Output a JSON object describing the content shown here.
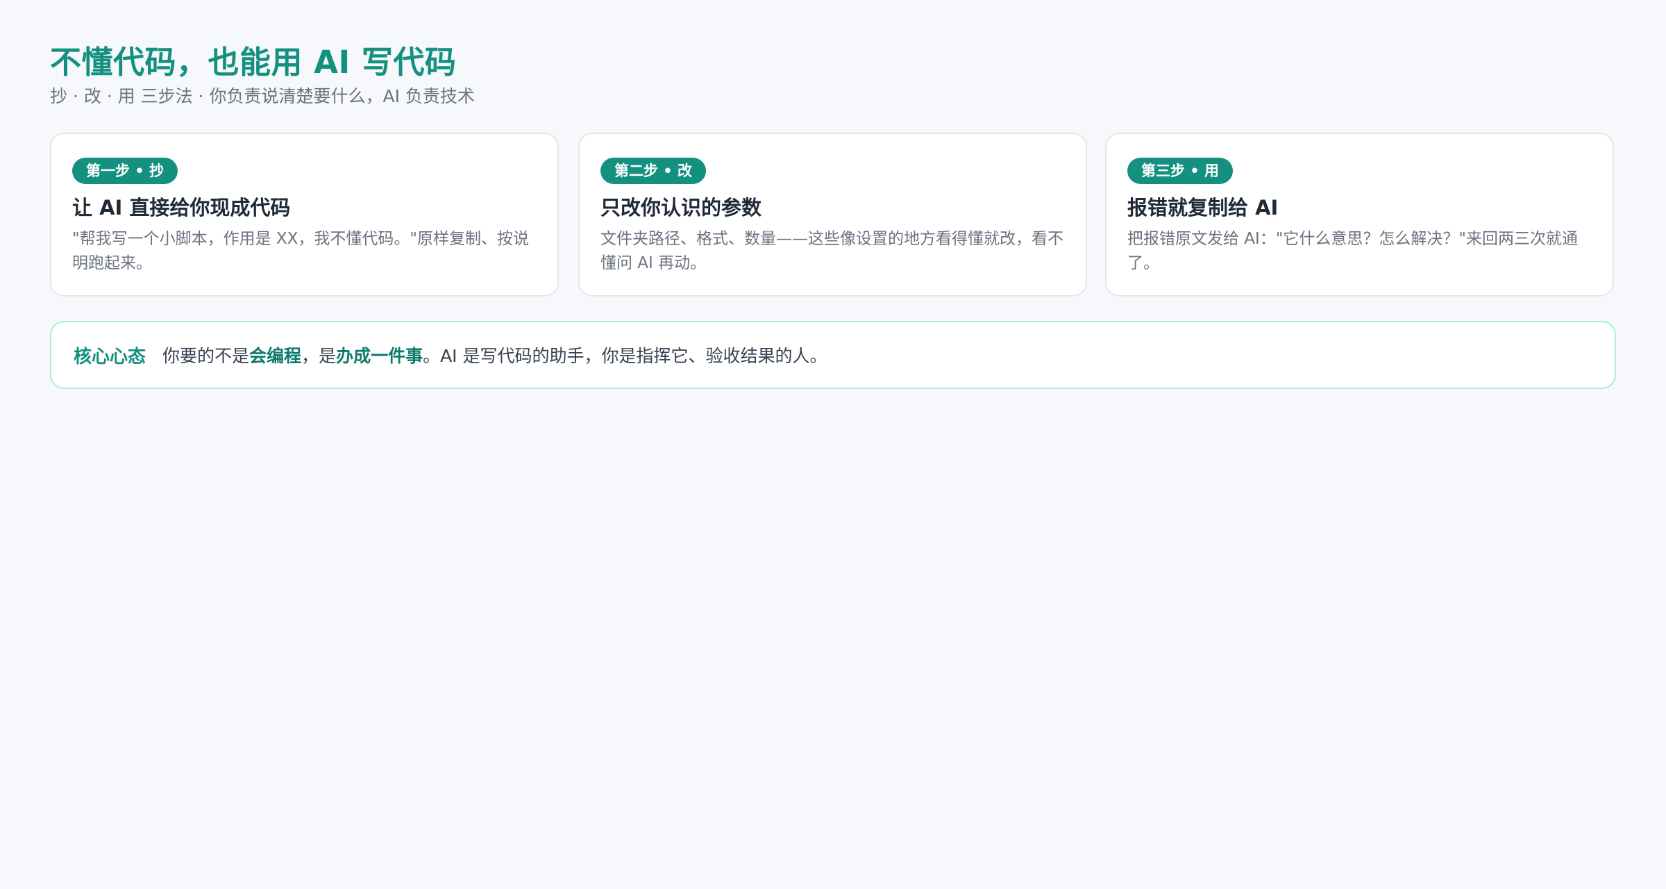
{
  "header": {
    "title": "不懂代码，也能用 AI 写代码",
    "subtitle": "抄 · 改 · 用 三步法 · 你负责说清楚要什么，AI 负责技术"
  },
  "steps": [
    {
      "badge": "第一步 • 抄",
      "title": "让 AI 直接给你现成代码",
      "body": "\"帮我写一个小脚本，作用是 XX，我不懂代码。\"原样复制、按说明跑起来。"
    },
    {
      "badge": "第二步 • 改",
      "title": "只改你认识的参数",
      "body": "文件夹路径、格式、数量——这些像设置的地方看得懂就改，看不懂问 AI 再动。"
    },
    {
      "badge": "第三步 • 用",
      "title": "报错就复制给 AI",
      "body": "把报错原文发给 AI：\"它什么意思？怎么解决？\"来回两三次就通了。"
    }
  ],
  "mindset": {
    "label": "核心心态",
    "text_1": "你要的不是",
    "em_1": "会编程",
    "text_2": "，是",
    "em_2": "办成一件事",
    "text_3": "。AI 是写代码的助手，你是指挥它、验收结果的人。"
  },
  "colors": {
    "accent": "#13907f",
    "background": "#f6f8fb",
    "mindset_border": "#a7f0dc"
  }
}
